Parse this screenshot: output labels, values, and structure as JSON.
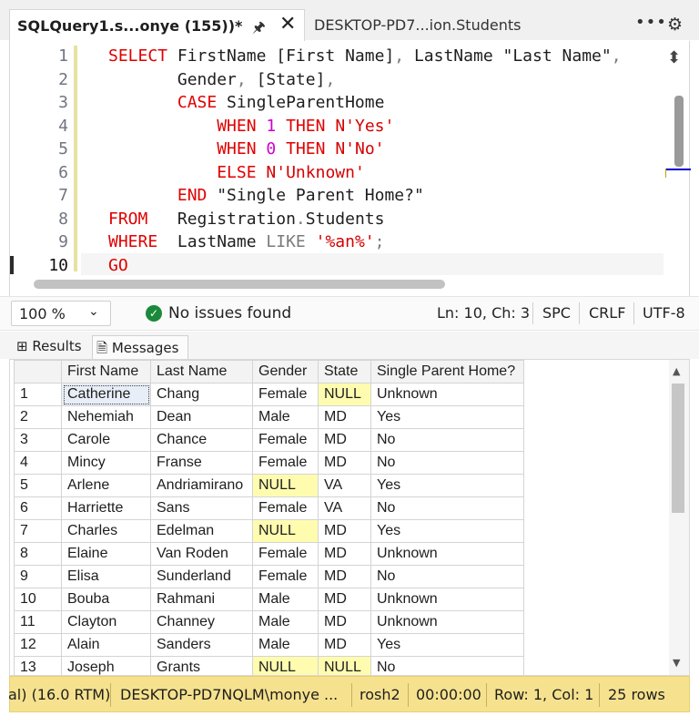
{
  "tabs": {
    "active_title": "SQLQuery1.s...onye (155))*",
    "inactive_title": "DESKTOP-PD7...ion.Students"
  },
  "editor": {
    "line_numbers": [
      "1",
      "2",
      "3",
      "4",
      "5",
      "6",
      "7",
      "8",
      "9",
      "10"
    ],
    "lines": [
      [
        {
          "t": "SELECT",
          "c": "kw"
        },
        {
          "t": " FirstName [First Name]",
          "c": ""
        },
        {
          "t": ",",
          "c": "gray"
        },
        {
          "t": " LastName \"Last Name\"",
          "c": ""
        },
        {
          "t": ",",
          "c": "gray"
        }
      ],
      [
        {
          "t": "       Gender",
          "c": ""
        },
        {
          "t": ",",
          "c": "gray"
        },
        {
          "t": " [State]",
          "c": ""
        },
        {
          "t": ",",
          "c": "gray"
        }
      ],
      [
        {
          "t": "       ",
          "c": ""
        },
        {
          "t": "CASE",
          "c": "kw"
        },
        {
          "t": " SingleParentHome",
          "c": ""
        }
      ],
      [
        {
          "t": "           ",
          "c": ""
        },
        {
          "t": "WHEN",
          "c": "kw"
        },
        {
          "t": " ",
          "c": ""
        },
        {
          "t": "1",
          "c": "num"
        },
        {
          "t": " ",
          "c": ""
        },
        {
          "t": "THEN",
          "c": "kw"
        },
        {
          "t": " ",
          "c": ""
        },
        {
          "t": "N'Yes'",
          "c": "str"
        }
      ],
      [
        {
          "t": "           ",
          "c": ""
        },
        {
          "t": "WHEN",
          "c": "kw"
        },
        {
          "t": " ",
          "c": ""
        },
        {
          "t": "0",
          "c": "num"
        },
        {
          "t": " ",
          "c": ""
        },
        {
          "t": "THEN",
          "c": "kw"
        },
        {
          "t": " ",
          "c": ""
        },
        {
          "t": "N'No'",
          "c": "str"
        }
      ],
      [
        {
          "t": "           ",
          "c": ""
        },
        {
          "t": "ELSE",
          "c": "kw"
        },
        {
          "t": " ",
          "c": ""
        },
        {
          "t": "N'Unknown'",
          "c": "str"
        }
      ],
      [
        {
          "t": "       ",
          "c": ""
        },
        {
          "t": "END",
          "c": "kw"
        },
        {
          "t": " \"Single Parent Home?\"",
          "c": ""
        }
      ],
      [
        {
          "t": "FROM",
          "c": "kw"
        },
        {
          "t": "   Registration",
          "c": ""
        },
        {
          "t": ".",
          "c": "gray"
        },
        {
          "t": "Students",
          "c": ""
        }
      ],
      [
        {
          "t": "WHERE",
          "c": "kw"
        },
        {
          "t": "  LastName ",
          "c": ""
        },
        {
          "t": "LIKE",
          "c": "gray"
        },
        {
          "t": " ",
          "c": ""
        },
        {
          "t": "'%an%'",
          "c": "str"
        },
        {
          "t": ";",
          "c": "gray"
        }
      ],
      [
        {
          "t": "GO",
          "c": "kw"
        }
      ]
    ]
  },
  "editor_status": {
    "zoom": "100 %",
    "issues": "No issues found",
    "position": "Ln: 10, Ch: 3",
    "whitespace": "SPC",
    "line_ending": "CRLF",
    "encoding": "UTF-8"
  },
  "result_tabs": {
    "results": "Results",
    "messages": "Messages"
  },
  "grid": {
    "columns": [
      "First Name",
      "Last Name",
      "Gender",
      "State",
      "Single Parent Home?"
    ],
    "rows": [
      [
        "1",
        "Catherine",
        "Chang",
        "Female",
        "NULL",
        "Unknown"
      ],
      [
        "2",
        "Nehemiah",
        "Dean",
        "Male",
        "MD",
        "Yes"
      ],
      [
        "3",
        "Carole",
        "Chance",
        "Female",
        "MD",
        "No"
      ],
      [
        "4",
        "Mincy",
        "Franse",
        "Female",
        "MD",
        "No"
      ],
      [
        "5",
        "Arlene",
        "Andriamirano",
        "NULL",
        "VA",
        "Yes"
      ],
      [
        "6",
        "Harriette",
        "Sans",
        "Female",
        "VA",
        "No"
      ],
      [
        "7",
        "Charles",
        "Edelman",
        "NULL",
        "MD",
        "Yes"
      ],
      [
        "8",
        "Elaine",
        "Van Roden",
        "Female",
        "MD",
        "Unknown"
      ],
      [
        "9",
        "Elisa",
        "Sunderland",
        "Female",
        "MD",
        "No"
      ],
      [
        "10",
        "Bouba",
        "Rahmani",
        "Male",
        "MD",
        "Unknown"
      ],
      [
        "11",
        "Clayton",
        "Channey",
        "Male",
        "MD",
        "Unknown"
      ],
      [
        "12",
        "Alain",
        "Sanders",
        "Male",
        "MD",
        "Yes"
      ],
      [
        "13",
        "Joseph",
        "Grants",
        "NULL",
        "NULL",
        "No"
      ]
    ]
  },
  "bottom_status": {
    "version": "al) (16.0 RTM)",
    "server_user": "DESKTOP-PD7NQLM\\monye ...",
    "database": "rosh2",
    "elapsed": "00:00:00",
    "row_col": "Row: 1, Col: 1",
    "row_count": "25 rows"
  },
  "colors": {
    "keyword": "#e00000",
    "number": "#d000d0",
    "string": "#d40000",
    "null_cell": "#fffcb0",
    "status_bar": "#f6e28e"
  }
}
